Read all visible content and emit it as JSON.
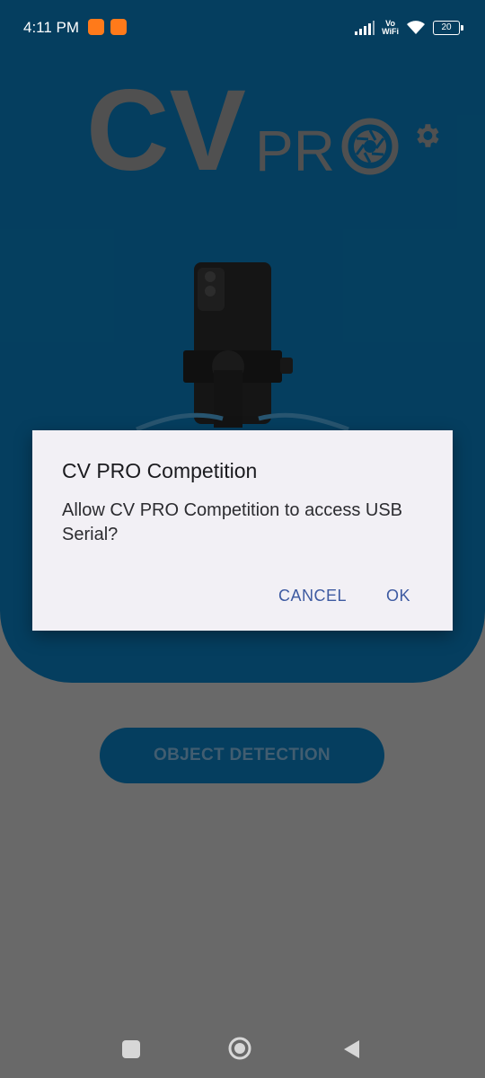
{
  "status_bar": {
    "time": "4:11 PM",
    "network_label_top": "Vo",
    "network_label_bottom": "WiFi",
    "battery_level": "20",
    "icons": [
      "video-call-notification-icon",
      "video-call-notification-icon",
      "signal-icon",
      "wifi-icon",
      "battery-icon"
    ]
  },
  "app": {
    "logo_text_main": "CV",
    "logo_text_sub": "PR",
    "object_detection_button": "OBJECT DETECTION",
    "colors": {
      "brand_blue": "#0a78b6",
      "logo_gray": "#9a9a9a"
    }
  },
  "dialog": {
    "title": "CV PRO Competition",
    "message": "Allow CV PRO Competition to access USB Serial?",
    "cancel_label": "CANCEL",
    "ok_label": "OK",
    "colors": {
      "button_text": "#3d5aa1",
      "surface": "#f2f0f5"
    }
  },
  "nav_bar": {
    "icons": [
      "recent-apps-icon",
      "home-icon",
      "back-icon"
    ]
  }
}
